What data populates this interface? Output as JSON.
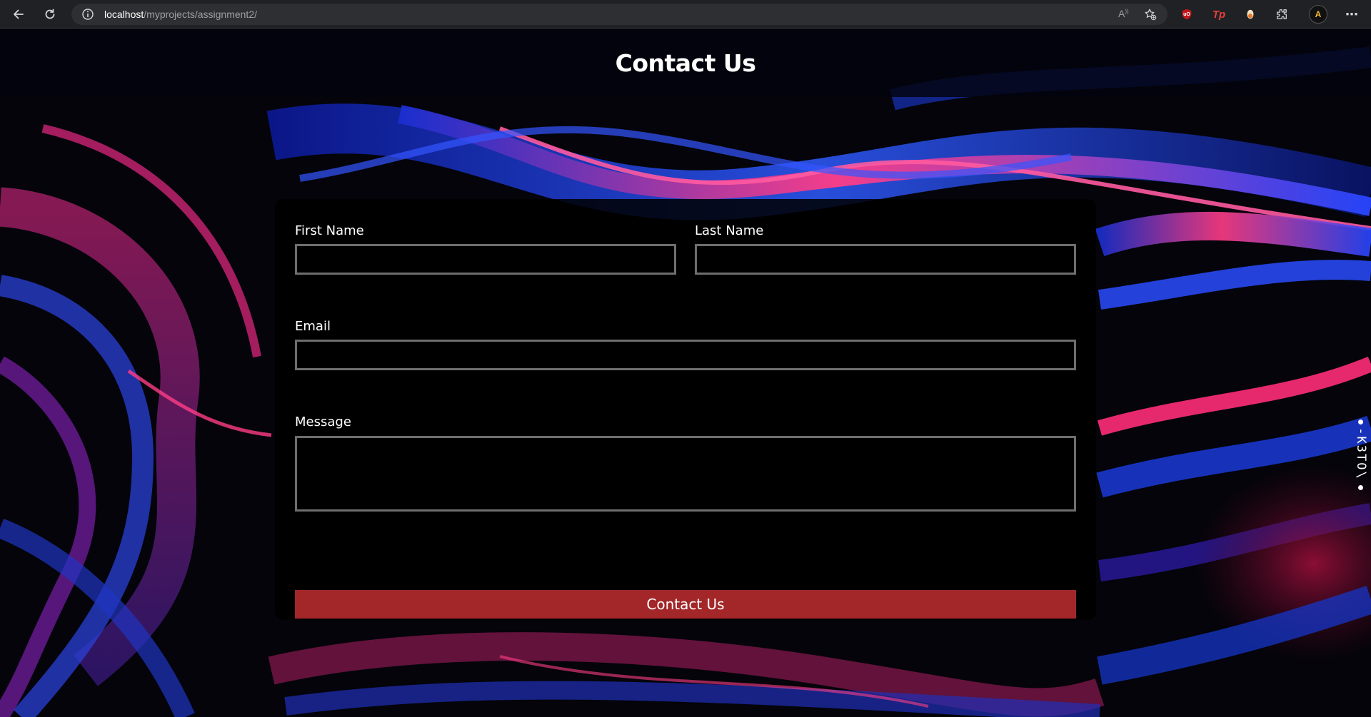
{
  "browser": {
    "url_host": "localhost",
    "url_path": "/myprojects/assignment2/",
    "icons": {
      "back": "back-arrow-icon",
      "reload": "reload-icon",
      "site_info": "info-icon",
      "read_aloud": "read-aloud-icon",
      "favorite": "add-favorite-icon",
      "extensions": [
        "ublock-extension-icon",
        "tp-extension-icon",
        "pin-extension-icon",
        "extensions-puzzle-icon"
      ],
      "profile": "profile-avatar-icon",
      "more": "more-menu-icon"
    },
    "ext_text": {
      "ublock": "uO",
      "tp": "Tp"
    },
    "read_aloud_text": "A",
    "profile_letter": "A"
  },
  "page": {
    "title": "Contact Us",
    "accent_color": "#a32729"
  },
  "form": {
    "first_name_label": "First Name",
    "first_name_value": "",
    "last_name_label": "Last Name",
    "last_name_value": "",
    "email_label": "Email",
    "email_value": "",
    "message_label": "Message",
    "message_value": "",
    "submit_label": "Contact Us"
  },
  "side_widget": {
    "label": "-K3TO\\"
  }
}
